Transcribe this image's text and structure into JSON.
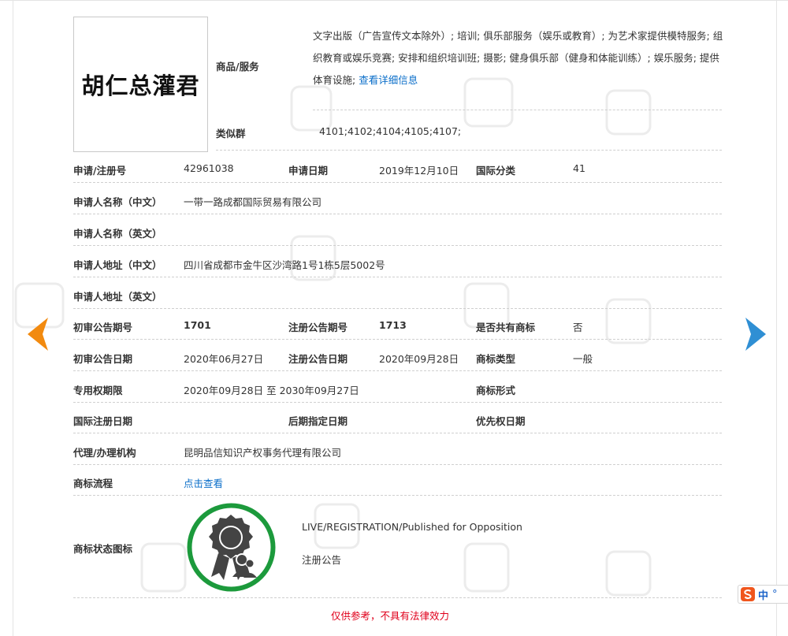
{
  "mark": {
    "logo_text": "胡仁总灌君"
  },
  "goods": {
    "label": "商品/服务",
    "text": "文字出版（广告宣传文本除外）; 培训; 俱乐部服务（娱乐或教育）; 为艺术家提供模特服务; 组织教育或娱乐竞赛; 安排和组织培训班; 摄影; 健身俱乐部（健身和体能训练）; 娱乐服务; 提供体育设施;",
    "detail_link": "查看详细信息"
  },
  "similar": {
    "label": "类似群",
    "value": "4101;4102;4104;4105;4107;"
  },
  "reg_no": {
    "label": "申请/注册号",
    "value": "42961038"
  },
  "apply_date": {
    "label": "申请日期",
    "value": "2019年12月10日"
  },
  "intl_class": {
    "label": "国际分类",
    "value": "41"
  },
  "applicant_cn": {
    "label": "申请人名称（中文）",
    "value": "一带一路成都国际贸易有限公司"
  },
  "applicant_en": {
    "label": "申请人名称（英文）",
    "value": ""
  },
  "address_cn": {
    "label": "申请人地址（中文）",
    "value": "四川省成都市金牛区沙湾路1号1栋5层5002号"
  },
  "address_en": {
    "label": "申请人地址（英文）",
    "value": ""
  },
  "prelim_issue": {
    "label": "初审公告期号",
    "value": "1701"
  },
  "reg_issue": {
    "label": "注册公告期号",
    "value": "1713"
  },
  "shared": {
    "label": "是否共有商标",
    "value": "否"
  },
  "prelim_date": {
    "label": "初审公告日期",
    "value": "2020年06月27日"
  },
  "reg_date": {
    "label": "注册公告日期",
    "value": "2020年09月28日"
  },
  "mark_type": {
    "label": "商标类型",
    "value": "一般"
  },
  "exclusive": {
    "label": "专用权期限",
    "value": "2020年09月28日 至 2030年09月27日"
  },
  "mark_form": {
    "label": "商标形式",
    "value": ""
  },
  "intl_reg_date": {
    "label": "国际注册日期",
    "value": ""
  },
  "later_date": {
    "label": "后期指定日期",
    "value": ""
  },
  "priority_date": {
    "label": "优先权日期",
    "value": ""
  },
  "agent": {
    "label": "代理/办理机构",
    "value": "昆明品信知识产权事务代理有限公司"
  },
  "process": {
    "label": "商标流程",
    "link": "点击查看"
  },
  "status": {
    "label": "商标状态图标",
    "en": "LIVE/REGISTRATION/Published for Opposition",
    "cn": "注册公告"
  },
  "disclaimer": "仅供参考，不具有法律效力",
  "ime": {
    "label": "中"
  },
  "nav": {
    "prev_icon": "chevron-left-icon",
    "next_icon": "chevron-right-icon",
    "prev_color": "#f28a0f",
    "next_color": "#2f8fd4"
  },
  "colors": {
    "link": "#0a6ec9",
    "disclaimer": "#e0001b",
    "seal_ring": "#1c9a3c"
  }
}
